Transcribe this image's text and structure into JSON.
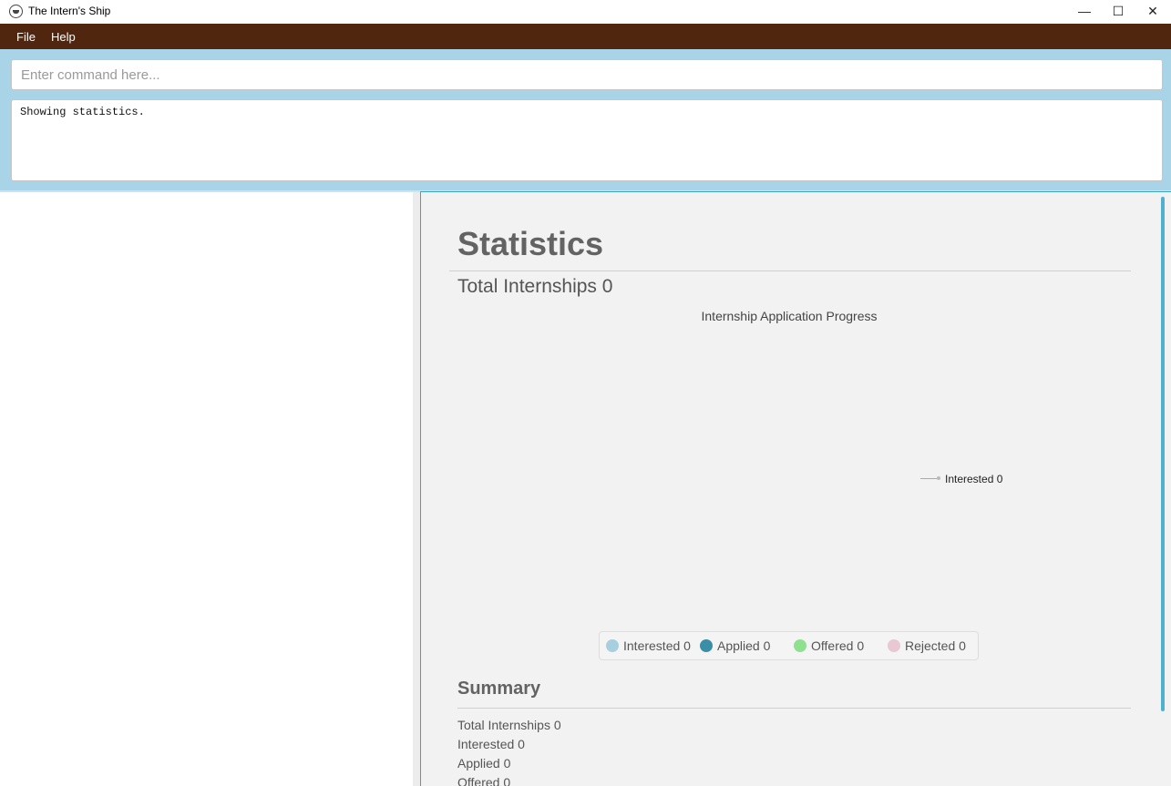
{
  "window": {
    "title": "The Intern's Ship",
    "minimize_glyph": "—",
    "maximize_glyph": "☐",
    "close_glyph": "✕"
  },
  "menu": {
    "file": "File",
    "help": "Help"
  },
  "command": {
    "placeholder": "Enter command here...",
    "value": ""
  },
  "result": {
    "text": "Showing statistics."
  },
  "statistics": {
    "title": "Statistics",
    "total_line": "Total Internships 0",
    "chart_title": "Internship Application Progress",
    "pie_label": "Interested 0"
  },
  "chart_data": {
    "type": "pie",
    "title": "Internship Application Progress",
    "categories": [
      "Interested",
      "Applied",
      "Offered",
      "Rejected"
    ],
    "values": [
      0,
      0,
      0,
      0
    ],
    "colors": [
      "#a8cfe0",
      "#3a8ea6",
      "#8fe08f",
      "#e8c8d4"
    ],
    "legend": "bottom",
    "legend_labels": [
      "Interested 0",
      "Applied 0",
      "Offered 0",
      "Rejected 0"
    ]
  },
  "summary": {
    "title": "Summary",
    "lines": [
      "Total Internships 0",
      "Interested 0",
      "Applied 0",
      "Offered 0"
    ]
  }
}
